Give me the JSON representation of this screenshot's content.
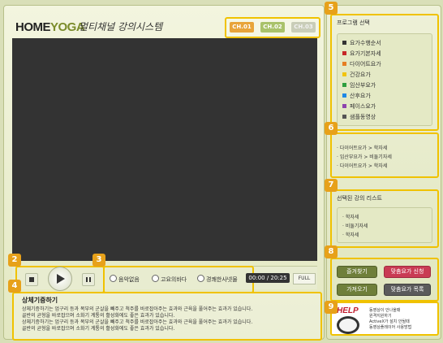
{
  "header": {
    "brand_main": "HOME",
    "brand_accent": "YOGA",
    "subtitle": "멀티채널 강의시스템",
    "channels": [
      "CH.01",
      "CH.02",
      "CH.03"
    ]
  },
  "controls": {
    "radio_options": [
      "음악없음",
      "고요의바다",
      "경쾌한사넷물"
    ],
    "time": "00:00 / 20:25",
    "full": "FULL"
  },
  "description": {
    "title": "상체기증하기",
    "lines": [
      "상체기증하기는 엄구리 등과 복부의 군살을 빼주고 척주를 바로잡아주는 효과와 근육을 풀어주는 효과가 있습니다.",
      "골반의 균형을 바로잡으며 소화기 계통의 활성화에도 좋은 효과가 있습니다.",
      "상체기증하기는 엄구리 등과 복부의 군살을 빼주고 척주를 바로잡아주는 효과와 근육을 풀어주는 효과가 있습니다.",
      "골반의 균형을 바로잡으며 소화기 계통의 활성화에도 좋은 효과가 있습니다."
    ]
  },
  "sidebar": {
    "program_title": "프로그램 선택",
    "programs": [
      {
        "label": "요가수행순서",
        "color": "#333333"
      },
      {
        "label": "요가기본자세",
        "color": "#c62828"
      },
      {
        "label": "다이어트요가",
        "color": "#e67e22"
      },
      {
        "label": "건강요가",
        "color": "#f1c40f"
      },
      {
        "label": "임산부요가",
        "color": "#2e9e3e"
      },
      {
        "label": "산후요가",
        "color": "#1e88e5"
      },
      {
        "label": "페이스요가",
        "color": "#8e44ad"
      },
      {
        "label": "샘플동영상",
        "color": "#555555"
      }
    ],
    "paths": [
      "· 다이어트요가 > 학자세",
      "· 임산부요가 > 비둘기자세",
      "· 다이어트요가 > 학자세"
    ],
    "selected_title": "선택된 강의 리스트",
    "selected": [
      "· 학자세",
      "· 비둘기자세",
      "· 학자세"
    ],
    "buttons": {
      "favorites": "즐겨찾기",
      "custom_apply": "맞춤요가 신청",
      "get": "가져오기",
      "custom_list": "맞춤요가 목록"
    },
    "help": {
      "title": "HELP",
      "lines": [
        "동영상이 안나올때",
        "원격지원하기",
        "ActiveX가 설치 안될때",
        "동영상플레이어 사용방법"
      ]
    }
  },
  "markers": [
    "2",
    "3",
    "4",
    "5",
    "6",
    "7",
    "8",
    "9"
  ]
}
